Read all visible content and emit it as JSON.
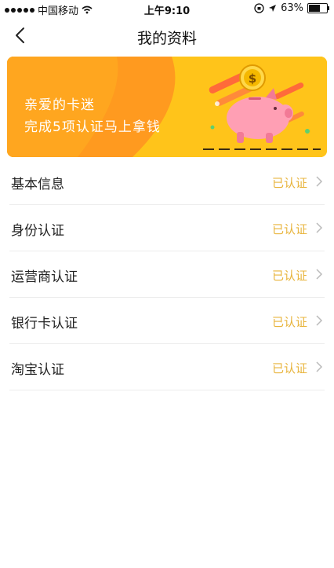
{
  "status_bar": {
    "carrier": "中国移动",
    "time": "上午9:10",
    "battery": "63%",
    "battery_level": 0.63
  },
  "nav": {
    "title": "我的资料"
  },
  "banner": {
    "line1": "亲爱的卡迷",
    "line2": "完成5项认证马上拿钱"
  },
  "items": [
    {
      "label": "基本信息",
      "status": "已认证"
    },
    {
      "label": "身份认证",
      "status": "已认证"
    },
    {
      "label": "运营商认证",
      "status": "已认证"
    },
    {
      "label": "银行卡认证",
      "status": "已认证"
    },
    {
      "label": "淘宝认证",
      "status": "已认证"
    }
  ],
  "colors": {
    "accent": "#e8b43c",
    "banner_bg": "#ffc41a",
    "banner_orange": "#ff9a1f"
  }
}
